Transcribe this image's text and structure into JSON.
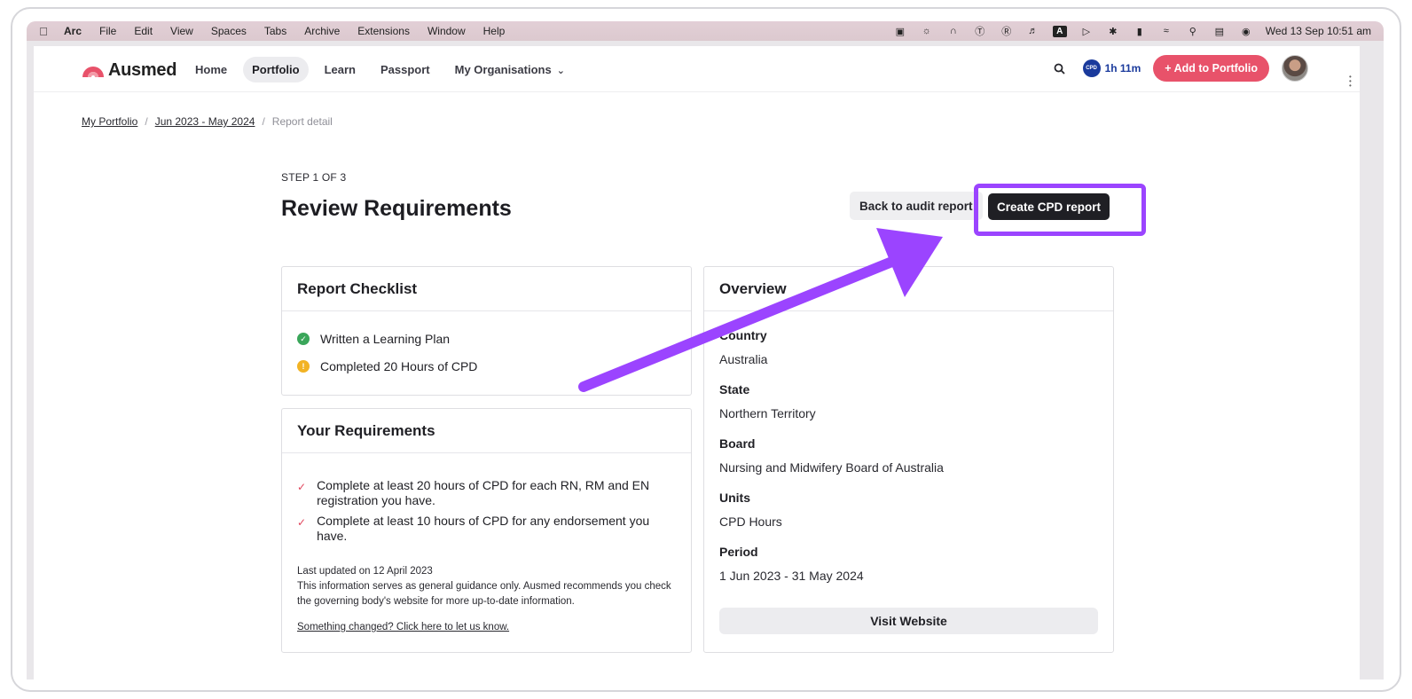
{
  "menubar": {
    "app": "Arc",
    "items": [
      "File",
      "Edit",
      "View",
      "Spaces",
      "Tabs",
      "Archive",
      "Extensions",
      "Window",
      "Help"
    ],
    "clock": "Wed 13 Sep  10:51 am",
    "icons": [
      "calendar-icon",
      "brightness-icon",
      "arc-icon",
      "onepassword-icon",
      "grammarly-icon",
      "volume-icon",
      "keyboard-input-icon",
      "play-icon",
      "bluetooth-icon",
      "battery-icon",
      "wifi-icon",
      "spotlight-search-icon",
      "control-center-icon",
      "siri-icon"
    ]
  },
  "nav": {
    "logo": "Ausmed",
    "links": [
      "Home",
      "Portfolio",
      "Learn",
      "Passport",
      "My Organisations"
    ],
    "active": "Portfolio",
    "cpd_badge": "CPD",
    "cpd_time": "1h 11m",
    "add_button": "+ Add to Portfolio"
  },
  "breadcrumb": {
    "items": [
      "My Portfolio",
      "Jun 2023 - May 2024"
    ],
    "current": "Report detail"
  },
  "header": {
    "step": "STEP 1 OF 3",
    "title": "Review Requirements",
    "back_button": "Back to audit report",
    "create_button": "Create CPD report"
  },
  "checklist": {
    "title": "Report Checklist",
    "items": [
      {
        "label": "Written a Learning Plan",
        "status": "complete"
      },
      {
        "label": "Completed 20 Hours of CPD",
        "status": "warning"
      }
    ]
  },
  "requirements": {
    "title": "Your Requirements",
    "items": [
      "Complete at least 20 hours of CPD for each RN, RM and EN registration you have.",
      "Complete at least 10 hours of CPD for any endorsement you have."
    ],
    "updated": "Last updated on 12 April 2023",
    "disclaimer": "This information serves as general guidance only. Ausmed recommends you check the governing body's website for more up-to-date information.",
    "feedback_link": "Something changed? Click here to let us know."
  },
  "overview": {
    "title": "Overview",
    "fields": [
      {
        "label": "Country",
        "value": "Australia"
      },
      {
        "label": "State",
        "value": "Northern Territory"
      },
      {
        "label": "Board",
        "value": "Nursing and Midwifery Board of Australia"
      },
      {
        "label": "Units",
        "value": "CPD Hours"
      },
      {
        "label": "Period",
        "value": "1 Jun 2023 - 31 May 2024"
      }
    ],
    "visit_button": "Visit Website"
  },
  "colors": {
    "accent_pink": "#e8526a",
    "highlight_purple": "#9b44ff",
    "dark_button": "#1f1f24",
    "cpd_blue": "#1a3a9c",
    "ok_green": "#3aa65a",
    "warn_yellow": "#f2b324"
  }
}
